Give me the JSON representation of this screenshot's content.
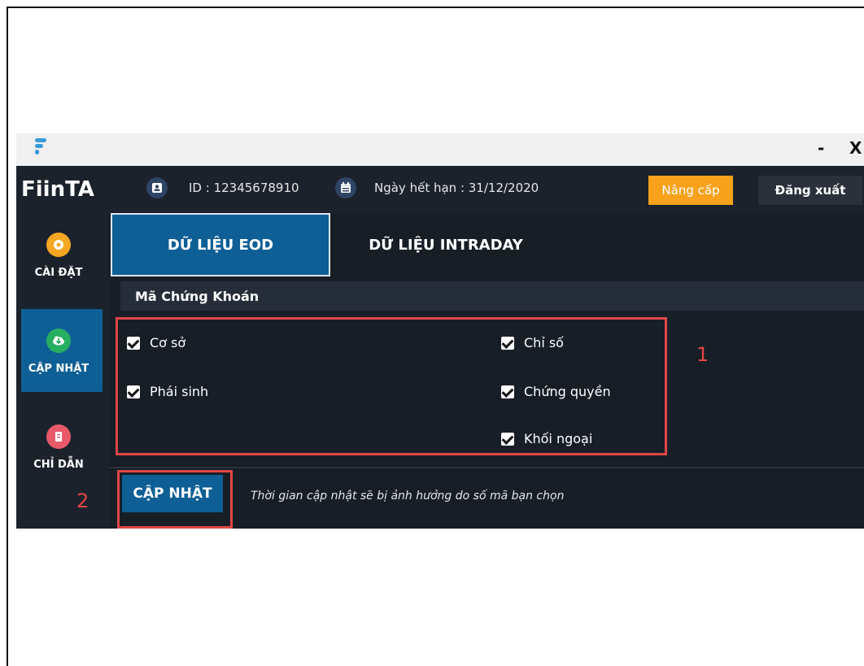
{
  "window": {
    "minimize_label": "-",
    "close_label": "X"
  },
  "header": {
    "brand": "FiinTA",
    "id_text": "ID : 12345678910",
    "expiry_text": "Ngày hết hạn : 31/12/2020",
    "upgrade_label": "Nâng cấp",
    "logout_label": "Đăng xuất"
  },
  "sidebar": {
    "items": [
      {
        "label": "CÀI ĐẶT",
        "icon": "gear-icon",
        "color": "#f5a623"
      },
      {
        "label": "CẬP NHẬT",
        "icon": "cloud-download-icon",
        "color": "#27ae60"
      },
      {
        "label": "CHỈ DẪN",
        "icon": "document-icon",
        "color": "#e85a6a"
      }
    ]
  },
  "tabs": [
    {
      "label": "DỮ LIỆU EOD",
      "active": true
    },
    {
      "label": "DỮ LIỆU INTRADAY",
      "active": false
    }
  ],
  "section": {
    "title": "Mã Chứng Khoán",
    "checkboxes": [
      {
        "label": "Cơ sở",
        "checked": true
      },
      {
        "label": "Phái sinh",
        "checked": true
      },
      {
        "label": "Chỉ số",
        "checked": true
      },
      {
        "label": "Chứng quyền",
        "checked": true
      },
      {
        "label": "Khối ngoại",
        "checked": true
      }
    ]
  },
  "annotations": {
    "one": "1",
    "two": "2"
  },
  "footer": {
    "update_label": "CẬP NHẬT",
    "note": "Thời gian cập nhật sẽ bị ảnh hưởng do số mã bạn chọn"
  },
  "colors": {
    "accent": "#0e5f95",
    "upgrade": "#f7a21a",
    "highlight": "#e04646",
    "background": "#1c222c"
  }
}
